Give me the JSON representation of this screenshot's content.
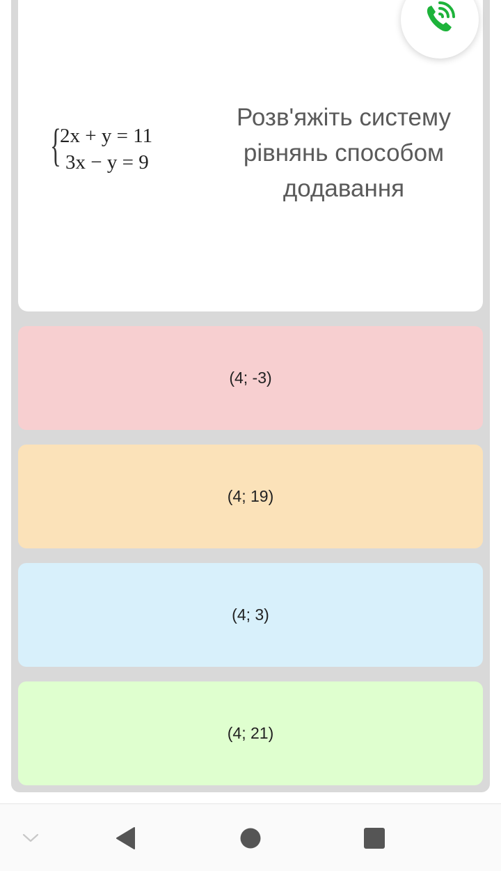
{
  "question": {
    "equations": [
      "2x + y = 11",
      "3x − y = 9"
    ],
    "text_lines": [
      "Розв'яжіть систему",
      "рівнянь способом",
      "додавання"
    ]
  },
  "call_button": {
    "icon": "phone-wifi-icon",
    "color": "#1db33a"
  },
  "answers": [
    {
      "label": "(4; -3)",
      "color": "#f7cfd0"
    },
    {
      "label": "(4; 19)",
      "color": "#fbe2b9"
    },
    {
      "label": "(4; 3)",
      "color": "#d8f0fb"
    },
    {
      "label": "(4; 21)",
      "color": "#dfffcf"
    }
  ],
  "nav_bar": {
    "icons": [
      "chevron-down-icon",
      "back-triangle-icon",
      "home-circle-icon",
      "recents-square-icon"
    ]
  }
}
